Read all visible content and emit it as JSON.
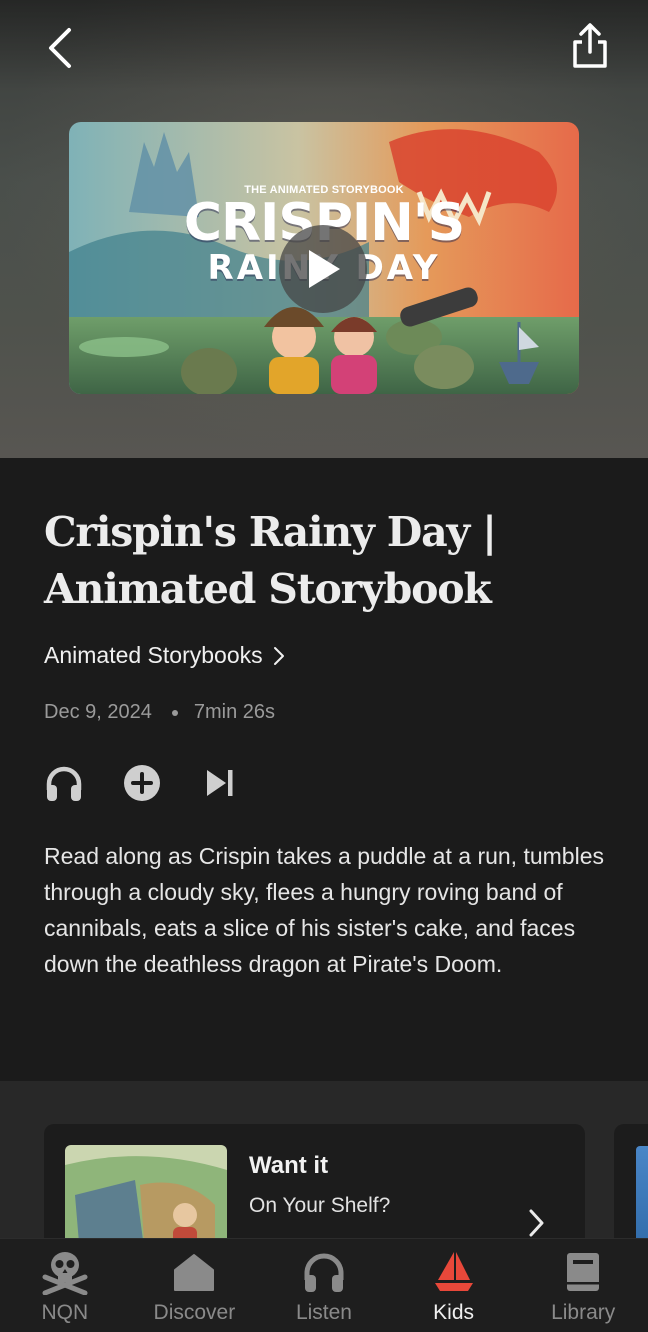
{
  "header": {
    "back_icon": "chevron-left-icon",
    "share_icon": "share-icon"
  },
  "thumbnail": {
    "subtitle": "THE ANIMATED STORYBOOK",
    "title_line1": "CRISPIN'S",
    "title_line2": "RAINY DAY",
    "play_icon": "play-icon"
  },
  "episode": {
    "title": "Crispin's Rainy Day | Animated Storybook",
    "series": "Animated Storybooks",
    "date": "Dec 9, 2024",
    "duration": "7min 26s",
    "actions": [
      "headphones-icon",
      "add-circle-icon",
      "play-next-icon"
    ],
    "description": "Read along as Crispin takes a puddle at a run, tumbles through a cloudy sky, flees a hungry roving band of cannibals, eats a slice of his sister's cake, and faces down the deathless dragon at Pirate's Doom."
  },
  "promo": {
    "title": "Want it",
    "subtitle": "On Your Shelf?"
  },
  "tabs": [
    {
      "label": "NQN",
      "icon": "skull-crossbones-icon",
      "active": false
    },
    {
      "label": "Discover",
      "icon": "house-icon",
      "active": false
    },
    {
      "label": "Listen",
      "icon": "headphones-icon",
      "active": false
    },
    {
      "label": "Kids",
      "icon": "sailboat-icon",
      "active": true
    },
    {
      "label": "Library",
      "icon": "book-icon",
      "active": false
    }
  ],
  "colors": {
    "background": "#1b1b1b",
    "accent": "#e8483a",
    "muted_text": "#9a9a9a"
  }
}
